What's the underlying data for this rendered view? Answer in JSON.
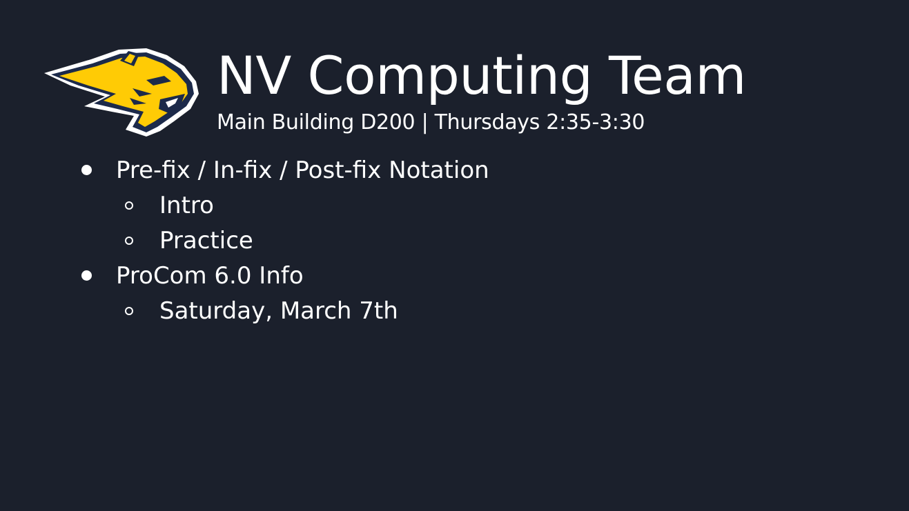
{
  "slide": {
    "title": "NV Computing Team",
    "subtitle": "Main Building D200 | Thursdays 2:35-3:30",
    "logo_icon": "wildcat-head-icon",
    "colors": {
      "background": "#1b202c",
      "text": "#ffffff",
      "logo_gold": "#ffcb05",
      "logo_navy": "#1c2a4a"
    },
    "bullets": [
      {
        "level": 1,
        "text": "Pre-fix / In-fix / Post-fix Notation"
      },
      {
        "level": 2,
        "text": "Intro"
      },
      {
        "level": 2,
        "text": "Practice"
      },
      {
        "level": 1,
        "text": "ProCom 6.0 Info"
      },
      {
        "level": 2,
        "text": "Saturday, March 7th"
      }
    ]
  }
}
